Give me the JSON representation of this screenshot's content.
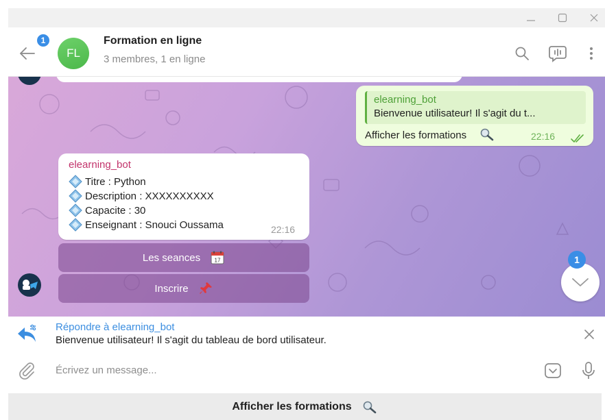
{
  "header": {
    "back_badge": "1",
    "avatar_initials": "FL",
    "title": "Formation en ligne",
    "subtitle": "3 membres, 1 en ligne"
  },
  "messages": {
    "outgoing": {
      "quote_sender": "elearning_bot",
      "quote_text": "Bienvenue utilisateur! Il s'agit du t...",
      "text": "Afficher les formations",
      "time": "22:16"
    },
    "incoming": {
      "sender": "elearning_bot",
      "lines": [
        "Titre : Python",
        "Description : XXXXXXXXXX",
        "Capacite : 30",
        "Enseignant : Snouci Oussama"
      ],
      "time": "22:16"
    },
    "inline_buttons": [
      {
        "label": "Les seances",
        "icon": "calendar-icon"
      },
      {
        "label": "Inscrire",
        "icon": "pushpin-icon"
      }
    ]
  },
  "scroll_down": {
    "badge": "1"
  },
  "reply": {
    "title": "Répondre à elearning_bot",
    "text": "Bienvenue utilisateur! Il s'agit du tableau de bord utilisateur."
  },
  "composer": {
    "placeholder": "Écrivez un message..."
  },
  "reply_keyboard": {
    "label": "Afficher les formations",
    "icon": "magnifier-icon"
  },
  "colors": {
    "accent": "#3a8ee6",
    "outgoing_bubble": "#effdde",
    "sender_name_incoming": "#c2336b",
    "sender_name_quote": "#4da037"
  }
}
